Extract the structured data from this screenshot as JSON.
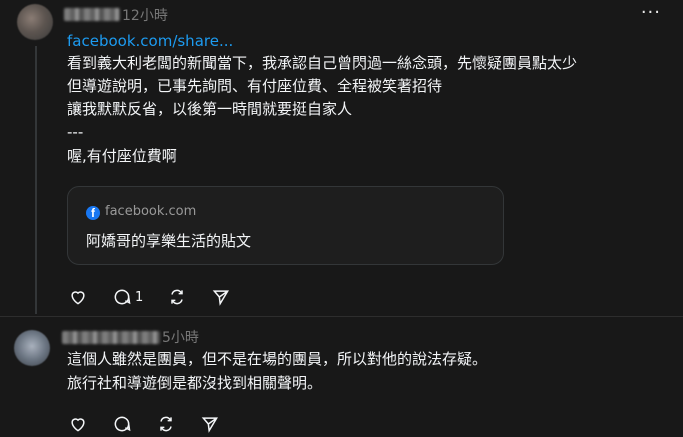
{
  "post1": {
    "time": "12小時",
    "link_text": "facebook.com/share...",
    "body_lines": [
      "看到義大利老闆的新聞當下，我承認自己曾閃過一絲念頭，先懷疑團員點太少",
      "但導遊說明，已事先詢問、有付座位費、全程被笑著招待",
      "讓我默默反省，以後第一時間就要挺自家人",
      "---",
      "喔,有付座位費啊"
    ],
    "card": {
      "domain": "facebook.com",
      "title": "阿嬌哥的享樂生活的貼文"
    },
    "actions": {
      "reply_count": "1"
    }
  },
  "post2": {
    "time": "5小時",
    "body_lines": [
      "這個人雖然是團員，但不是在場的團員，所以對他的說法存疑。",
      "旅行社和導遊倒是都沒找到相關聲明。"
    ]
  },
  "icons": {
    "more": "more-icon",
    "like": "heart-icon",
    "reply": "comment-icon",
    "repost": "repost-icon",
    "share": "send-icon",
    "card_logo": "facebook-logo-icon"
  },
  "colors": {
    "background": "#181818",
    "link": "#1d9bf0",
    "muted": "#777777"
  }
}
